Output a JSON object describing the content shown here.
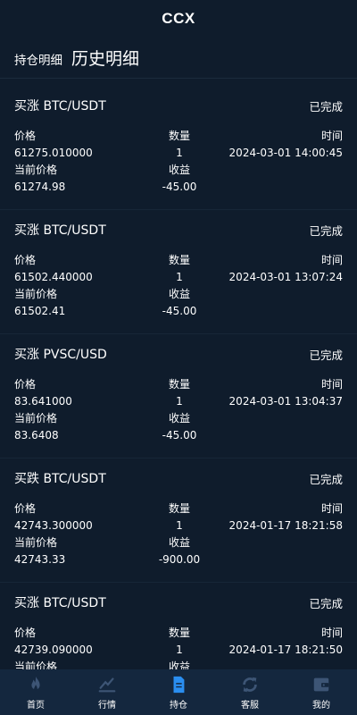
{
  "header": {
    "title": "CCX"
  },
  "tabs": {
    "holdings": "持仓明细",
    "history": "历史明细"
  },
  "labels": {
    "price": "价格",
    "quantity": "数量",
    "time": "时间",
    "current_price": "当前价格",
    "profit": "收益"
  },
  "orders": [
    {
      "title": "买涨 BTC/USDT",
      "status": "已完成",
      "price": "61275.010000",
      "quantity": "1",
      "time": "2024-03-01 14:00:45",
      "current_price": "61274.98",
      "profit": "-45.00"
    },
    {
      "title": "买涨 BTC/USDT",
      "status": "已完成",
      "price": "61502.440000",
      "quantity": "1",
      "time": "2024-03-01 13:07:24",
      "current_price": "61502.41",
      "profit": "-45.00"
    },
    {
      "title": "买涨 PVSC/USD",
      "status": "已完成",
      "price": "83.641000",
      "quantity": "1",
      "time": "2024-03-01 13:04:37",
      "current_price": "83.6408",
      "profit": "-45.00"
    },
    {
      "title": "买跌 BTC/USDT",
      "status": "已完成",
      "price": "42743.300000",
      "quantity": "1",
      "time": "2024-01-17 18:21:58",
      "current_price": "42743.33",
      "profit": "-900.00"
    },
    {
      "title": "买涨 BTC/USDT",
      "status": "已完成",
      "price": "42739.090000",
      "quantity": "1",
      "time": "2024-01-17 18:21:50",
      "current_price": "",
      "profit": ""
    }
  ],
  "tabbar": {
    "items": [
      {
        "label": "首页",
        "icon": "flame-icon",
        "color": "#3d5575"
      },
      {
        "label": "行情",
        "icon": "chart-icon",
        "color": "#3d5575"
      },
      {
        "label": "持仓",
        "icon": "document-icon",
        "color": "#2a8ef0"
      },
      {
        "label": "客服",
        "icon": "refresh-icon",
        "color": "#3d5575"
      },
      {
        "label": "我的",
        "icon": "wallet-icon",
        "color": "#3d5575"
      }
    ]
  }
}
